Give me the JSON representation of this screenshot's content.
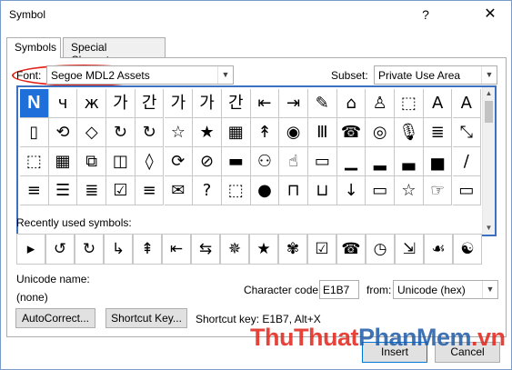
{
  "window": {
    "title": "Symbol",
    "help_glyph": "?",
    "close_glyph": "✕"
  },
  "tabs": [
    {
      "label": "Symbols"
    },
    {
      "label": "Special Characters"
    }
  ],
  "font": {
    "label": "Font:",
    "value": "Segoe MDL2 Assets"
  },
  "subset": {
    "label": "Subset:",
    "value": "Private Use Area"
  },
  "symbol_grid": [
    [
      "N",
      "ч",
      "ж",
      "가",
      "간",
      "가",
      "가",
      "간",
      "⇤",
      "⇥",
      "✎",
      "⌂",
      "♙",
      "⬚",
      "A",
      "A"
    ],
    [
      "▯",
      "⟲",
      "◇",
      "↻",
      "↻",
      "☆",
      "★",
      "▦",
      "↟",
      "◉",
      "Ⅲ",
      "☎",
      "◎",
      "🎙",
      "≣",
      "⤡"
    ],
    [
      "⬚",
      "▦",
      "⧉",
      "◫",
      "◊",
      "⟳",
      "⊘",
      "▬",
      "⚇",
      "☝",
      "▭",
      "▁",
      "▂",
      "▃",
      "▅",
      "/"
    ],
    [
      "≡",
      "☰",
      "≣",
      "☑",
      "≡",
      "✉",
      "?",
      "⬚",
      "●",
      "⊓",
      "⊔",
      "↓",
      "▭",
      "☆",
      "☞",
      "▭"
    ],
    [
      "",
      "",
      "",
      "",
      "",
      "",
      "",
      "",
      "",
      "",
      "",
      "",
      "",
      "",
      "",
      ""
    ]
  ],
  "recent": {
    "label": "Recently used symbols:",
    "items": [
      "▸",
      "↺",
      "↻",
      "↳",
      "⇞",
      "⇤",
      "⇆",
      "✵",
      "★",
      "✾",
      "☑",
      "☎",
      "◷",
      "⇲",
      "☙",
      "☯",
      "ఙ"
    ]
  },
  "unicode": {
    "label": "Unicode name:",
    "value": "(none)"
  },
  "charcode": {
    "label": "Character code:",
    "value": "E1B7",
    "from_label": "from:",
    "from_value": "Unicode (hex)"
  },
  "buttons": {
    "autocorrect": "AutoCorrect...",
    "shortcut": "Shortcut Key...",
    "shortcut_text": "Shortcut key: E1B7, Alt+X",
    "insert": "Insert",
    "cancel": "Cancel"
  },
  "watermark": {
    "part1": "ThuThuat",
    "part2": "PhanMem",
    "part3": ".vn"
  }
}
